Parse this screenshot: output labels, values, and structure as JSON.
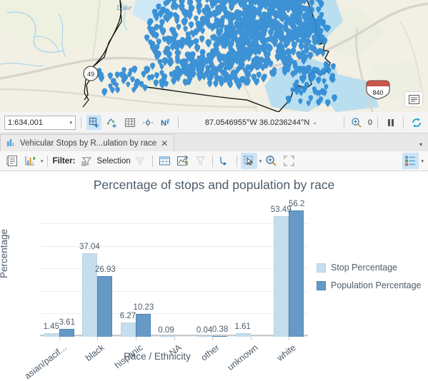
{
  "map": {
    "name": "vehicular-stops-map",
    "road_shield_label": "840",
    "interstate_marker": "840",
    "lake_label": "Lake",
    "route_marker": "49",
    "attribution_icon": "basemap-attribution-icon",
    "point_color": "#2e8bd4",
    "water_color": "#b9def0",
    "land_color": "#f1eee2"
  },
  "statusbar": {
    "scale": "1:634,001",
    "scale_caret": "▾",
    "coordinates": "87.0546955°W 36.0236244°N",
    "coord_caret": "⌄",
    "selection_count": "0",
    "buttons": [
      {
        "name": "select-features-button",
        "icon": "select-features-icon"
      },
      {
        "name": "select-by-polygon-button",
        "icon": "select-polygon-icon"
      },
      {
        "name": "attribute-table-button",
        "icon": "grid-icon"
      },
      {
        "name": "measure-button",
        "icon": "measure-icon"
      },
      {
        "name": "north-arrow-button",
        "icon": "north-arrow-icon"
      }
    ],
    "right_buttons": [
      {
        "name": "selection-count-button",
        "icon": "selection-count-icon"
      },
      {
        "name": "pause-drawing-button",
        "icon": "pause-icon"
      },
      {
        "name": "refresh-button",
        "icon": "refresh-icon"
      }
    ]
  },
  "tabstrip": {
    "tab_icon": "bar-chart-icon",
    "tab_title": "Vehicular Stops by R...ulation by race",
    "close_label": "✕",
    "overflow_caret": "▾"
  },
  "charttoolbar": {
    "properties_icon": "chart-properties-icon",
    "chart_type_icon": "chart-type-icon",
    "chart_type_caret": "▾",
    "filter_label": "Filter:",
    "selection_label": "Selection",
    "selection_icon": "filter-funnel-icon",
    "clear_filter_icon": "clear-filter-icon",
    "table_icon": "open-table-icon",
    "zoom_to_selection_icon": "zoom-to-selection-icon",
    "filter_extent_icon": "filter-extent-icon",
    "sort_icon": "sort-icon",
    "select_mode_icon": "select-cursor-icon",
    "select_mode_caret": "▾",
    "zoom_in_icon": "zoom-in-icon",
    "full-extent_icon": "full-extent-icon",
    "legend_icon": "legend-list-icon",
    "legend_caret": "▾"
  },
  "chart_data": {
    "type": "bar",
    "title": "Percentage of stops and population by race",
    "xlabel": "Race / Ethnicity",
    "ylabel": "Percentage",
    "categories": [
      "asian/pacif...",
      "black",
      "hispanic",
      "NA",
      "other",
      "unknown",
      "white"
    ],
    "series": [
      {
        "name": "Stop Percentage",
        "color": "#c5dded",
        "values": [
          1.45,
          37.04,
          6.27,
          0.09,
          0.04,
          1.61,
          53.49
        ]
      },
      {
        "name": "Population Percentage",
        "color": "#6699c6",
        "values": [
          3.61,
          26.93,
          10.23,
          null,
          0.38,
          null,
          56.2
        ]
      }
    ],
    "yticks": [
      0,
      10,
      20,
      30,
      40,
      50
    ],
    "ylim": [
      0,
      57
    ],
    "grid": true,
    "legend_position": "right"
  }
}
